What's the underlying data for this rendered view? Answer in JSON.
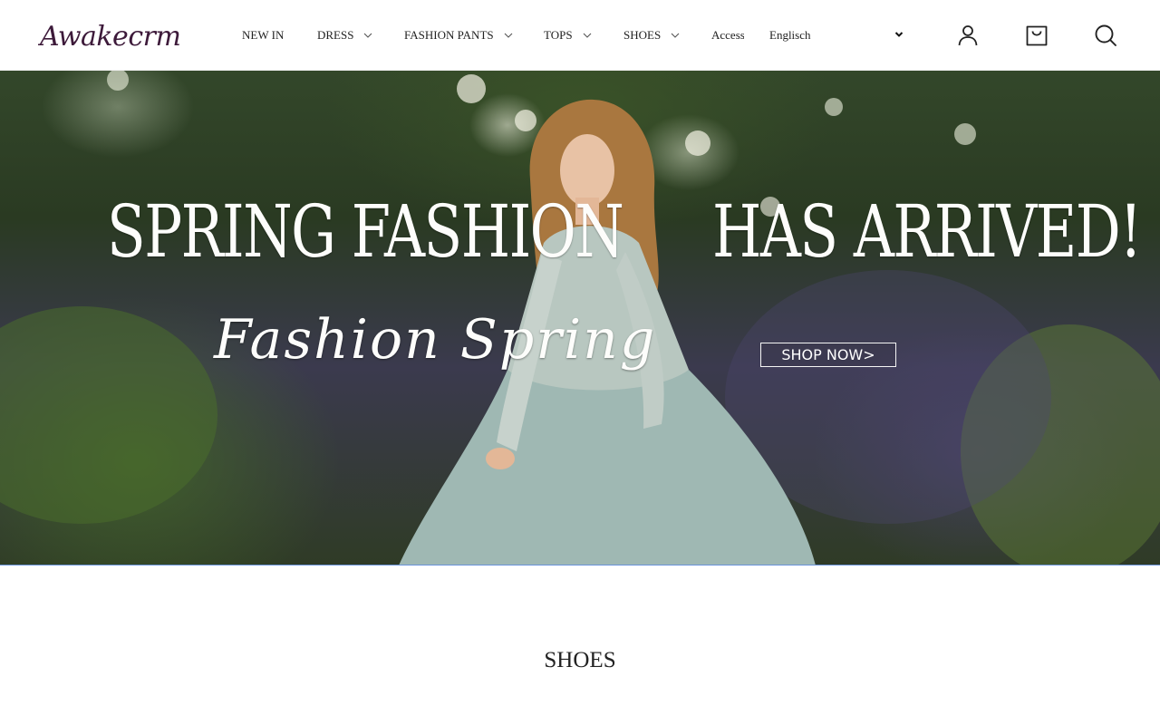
{
  "header": {
    "logo_text": "Awakecrm",
    "nav": [
      {
        "label": "NEW IN",
        "has_dropdown": false
      },
      {
        "label": "DRESS",
        "has_dropdown": true
      },
      {
        "label": "FASHION PANTS",
        "has_dropdown": true
      },
      {
        "label": "TOPS",
        "has_dropdown": true
      },
      {
        "label": "SHOES",
        "has_dropdown": true
      },
      {
        "label": "Access",
        "has_dropdown": false
      }
    ],
    "language": {
      "selected": "Englisch"
    },
    "icons": [
      "user-icon",
      "cart-icon",
      "search-icon"
    ]
  },
  "hero": {
    "headline_left": "SPRING FASHION",
    "headline_right": "HAS ARRIVED!",
    "script_text": "Fashion Spring",
    "cta_label": "SHOP NOW>",
    "strip_color": "#5b88d8"
  },
  "section": {
    "title": "SHOES"
  }
}
